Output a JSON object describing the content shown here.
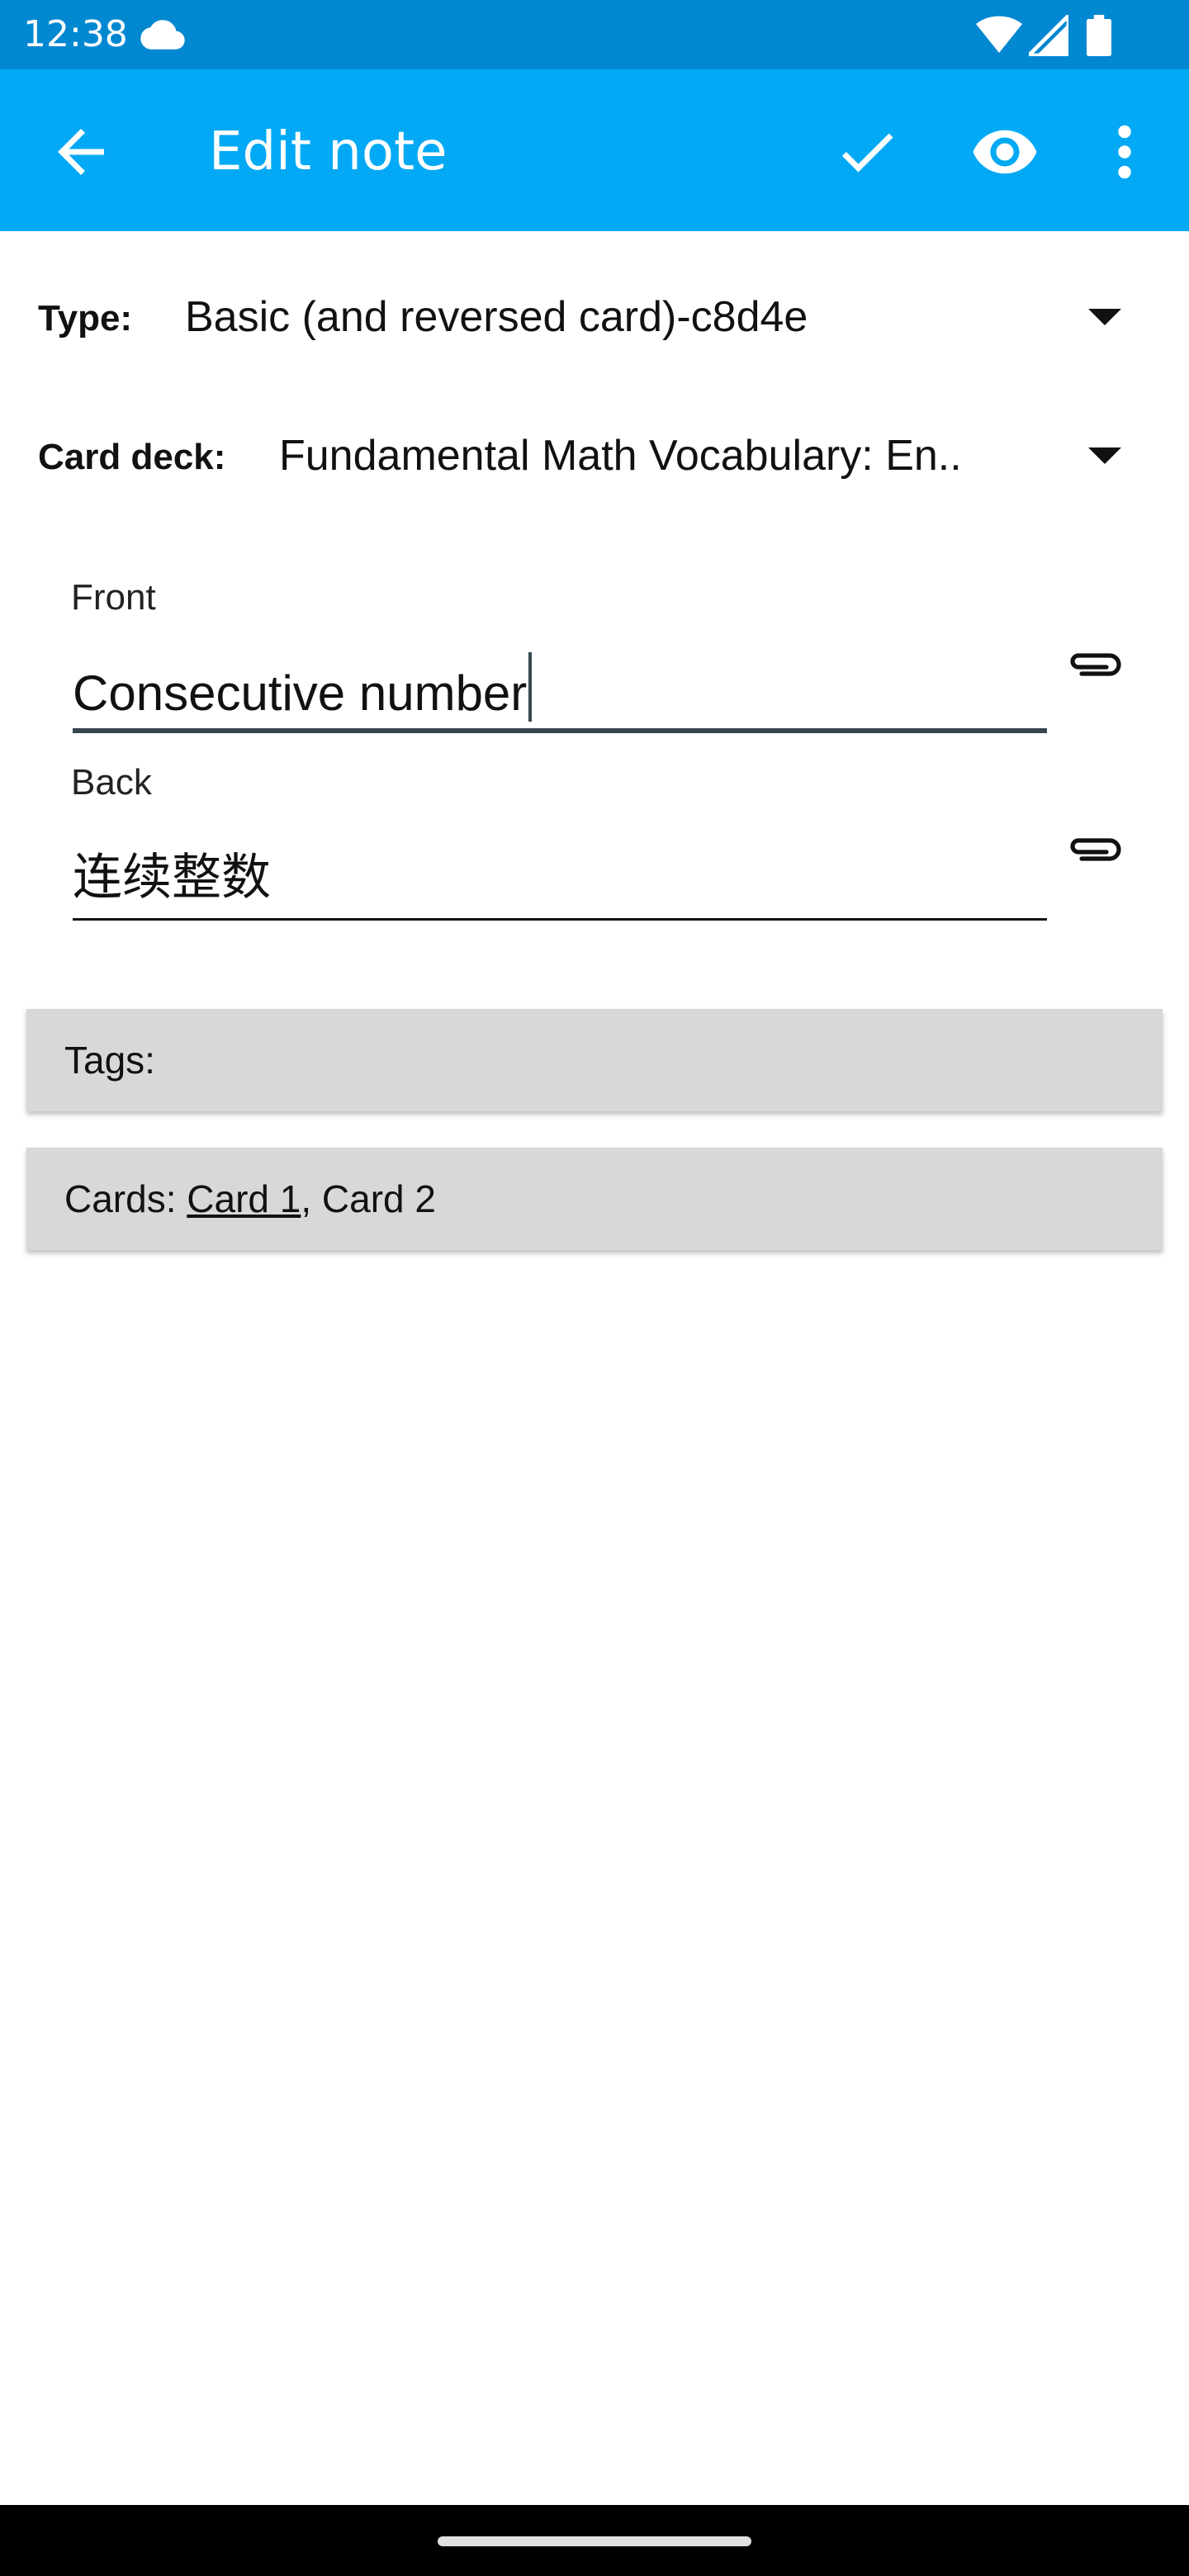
{
  "status_bar": {
    "time": "12:38",
    "icons": [
      "cloud-icon",
      "wifi-icon",
      "cell-signal-icon",
      "battery-icon"
    ]
  },
  "app_bar": {
    "title": "Edit note",
    "actions": [
      "back-arrow-icon",
      "check-icon",
      "eye-icon",
      "more-vert-icon"
    ]
  },
  "note_type": {
    "label": "Type:",
    "value": "Basic (and reversed card)-c8d4e"
  },
  "card_deck": {
    "label": "Card deck:",
    "value": "Fundamental Math Vocabulary: En.."
  },
  "fields": [
    {
      "label": "Front",
      "value": "Consecutive number"
    },
    {
      "label": "Back",
      "value": "连续整数"
    }
  ],
  "tags": {
    "label": "Tags:"
  },
  "cards": {
    "label": "Cards:",
    "card1": "Card 1",
    "separator": ",",
    "card2": "Card 2"
  },
  "colors": {
    "status_bar": "#0288d1",
    "app_bar": "#03a9f4",
    "panel": "#d7d8d8"
  }
}
